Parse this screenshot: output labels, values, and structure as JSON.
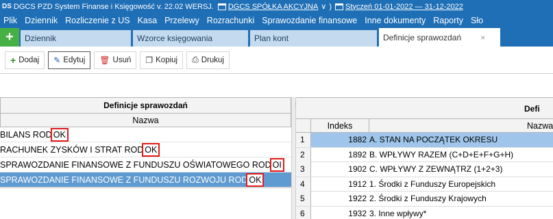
{
  "titlebar": {
    "logo": "DS",
    "app_title": "DGCS PZD System Finanse i Księgowość v. 22.02",
    "version_label": "WERSJ.",
    "company_link": "DGCS SPÓŁKA AKCYJNA",
    "dropdown_glyph": "∨",
    "paren_glyph": ")",
    "period_link": "Styczeń 01-01-2022 — 31-12-2022"
  },
  "menu": {
    "items": [
      "Plik",
      "Dziennik",
      "Rozliczenie z US",
      "Kasa",
      "Przelewy",
      "Rozrachunki",
      "Sprawozdanie finansowe",
      "Inne dokumenty",
      "Raporty",
      "Sło"
    ]
  },
  "tabs": {
    "add_glyph": "+",
    "items": [
      {
        "label": "Dziennik",
        "active": false
      },
      {
        "label": "Wzorce księgowania",
        "active": false
      },
      {
        "label": "Plan kont",
        "active": false
      },
      {
        "label": "Definicje sprawozdań",
        "active": true
      }
    ],
    "close_glyph": "×"
  },
  "toolbar": {
    "add_label": "Dodaj",
    "edit_label": "Edytuj",
    "delete_label": "Usuń",
    "copy_label": "Kopiuj",
    "print_label": "Drukuj"
  },
  "left_grid": {
    "title": "Definicje sprawozdań",
    "column": "Nazwa",
    "rows": [
      {
        "text": "BILANS ROD",
        "ok": "OK",
        "selected": false
      },
      {
        "text": "RACHUNEK ZYSKÓW I STRAT ROD",
        "ok": "OK",
        "selected": false
      },
      {
        "text": "SPRAWOZDANIE FINANSOWE Z FUNDUSZU OŚWIATOWEGO ROD",
        "ok": "OI",
        "selected": false
      },
      {
        "text": "SPRAWOZDANIE FINANSOWE Z FUNDUSZU ROZWOJU ROD",
        "ok": "OK",
        "selected": true
      }
    ]
  },
  "right_grid": {
    "title": "Defi",
    "col_index": "Indeks",
    "col_name": "Nazwa",
    "rows": [
      {
        "num": "1",
        "index": "1882",
        "name": "A. STAN NA POCZĄTEK OKRESU",
        "selected": true
      },
      {
        "num": "2",
        "index": "1892",
        "name": "B. WPŁYWY RAZEM (C+D+E+F+G+H)",
        "selected": false
      },
      {
        "num": "3",
        "index": "1902",
        "name": "C. WPŁYWY Z ZEWNĄTRZ (1+2+3)",
        "selected": false
      },
      {
        "num": "4",
        "index": "1912",
        "name": "1. Środki z Funduszy Europejskich",
        "selected": false
      },
      {
        "num": "5",
        "index": "1922",
        "name": "2. Środki z Funduszy Krajowych",
        "selected": false
      },
      {
        "num": "6",
        "index": "1932",
        "name": "3. Inne wpływy*",
        "selected": false
      }
    ]
  },
  "colors": {
    "title_blue": "#1f6fb6",
    "add_green": "#46b045",
    "selection_blue": "#5f9ad0",
    "highlight_red": "#e11919"
  }
}
